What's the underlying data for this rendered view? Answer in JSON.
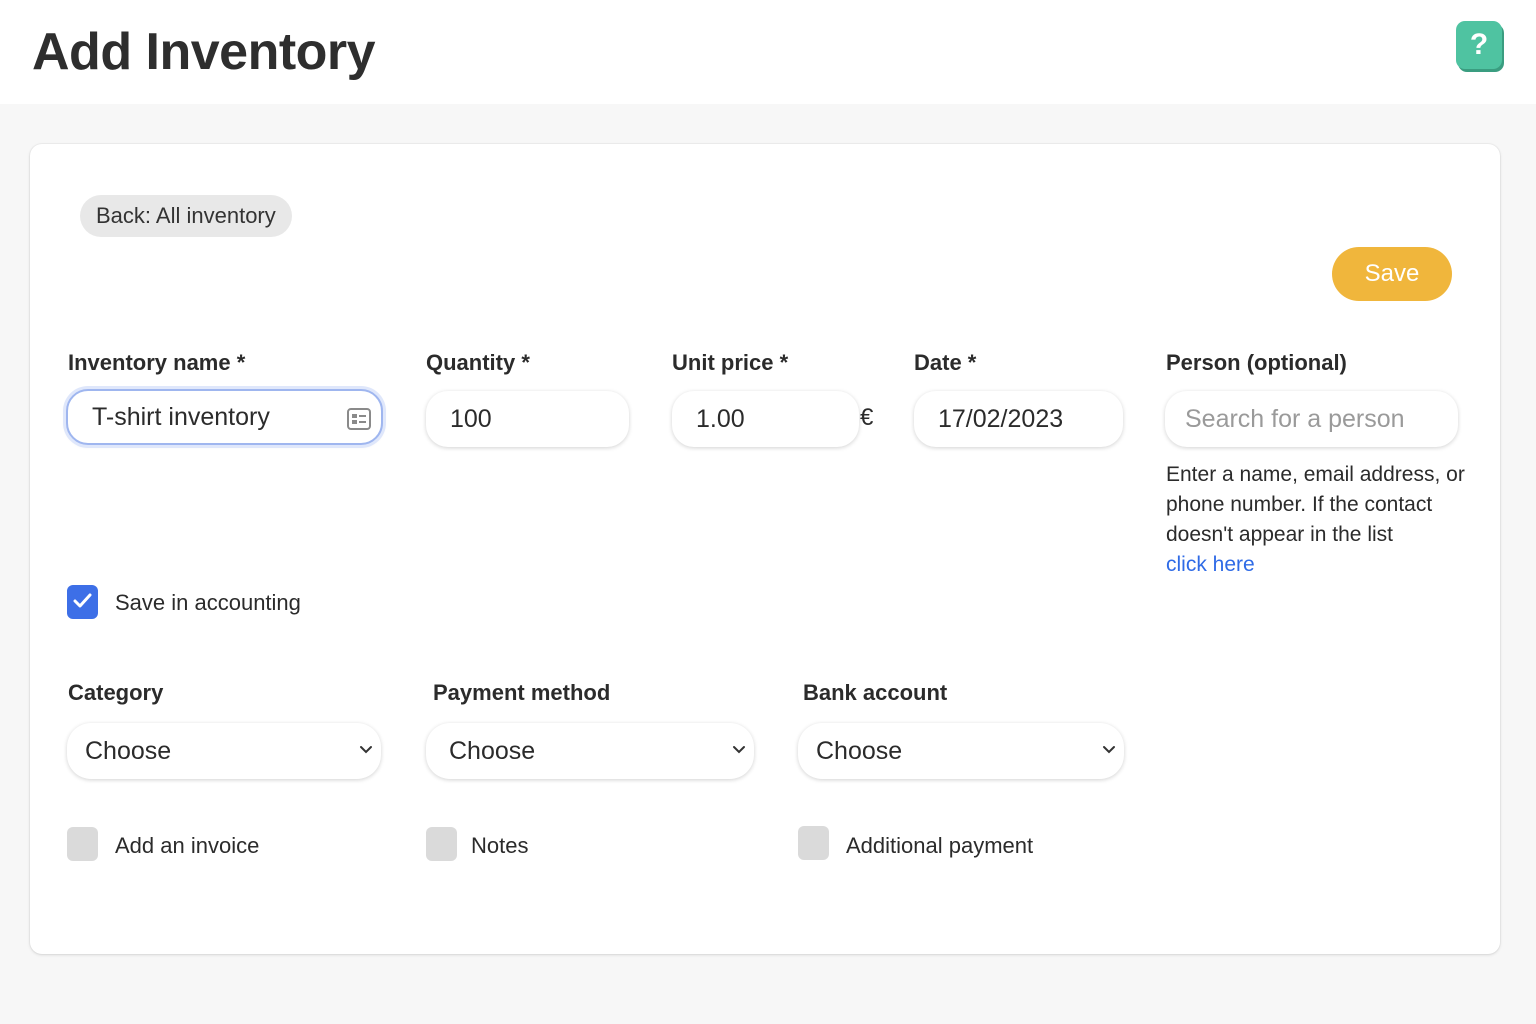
{
  "header": {
    "title": "Add Inventory",
    "help_label": "?"
  },
  "form": {
    "back_label": "Back: All inventory",
    "save_label": "Save",
    "inventory_name": {
      "label": "Inventory name *",
      "value": "T-shirt inventory"
    },
    "quantity": {
      "label": "Quantity *",
      "value": "100"
    },
    "unit_price": {
      "label": "Unit price *",
      "value": "1.00",
      "currency": "€"
    },
    "date": {
      "label": "Date *",
      "value": "17/02/2023"
    },
    "person": {
      "label": "Person (optional)",
      "placeholder": "Search for a person",
      "help": "Enter a name, email address, or phone number. If the contact doesn't appear in the list",
      "link": "click here"
    },
    "save_in_accounting": {
      "label": "Save in accounting",
      "checked": true
    },
    "category": {
      "label": "Category",
      "value": "Choose"
    },
    "payment_method": {
      "label": "Payment method",
      "value": "Choose"
    },
    "bank_account": {
      "label": "Bank account",
      "value": "Choose"
    },
    "add_invoice": {
      "label": "Add an invoice",
      "checked": false
    },
    "notes": {
      "label": "Notes",
      "checked": false
    },
    "additional_payment": {
      "label": "Additional payment",
      "checked": false
    }
  },
  "colors": {
    "accent": "#3d6fe7",
    "save": "#f0b63c",
    "help": "#4fc3a1",
    "link": "#2f6be6"
  }
}
